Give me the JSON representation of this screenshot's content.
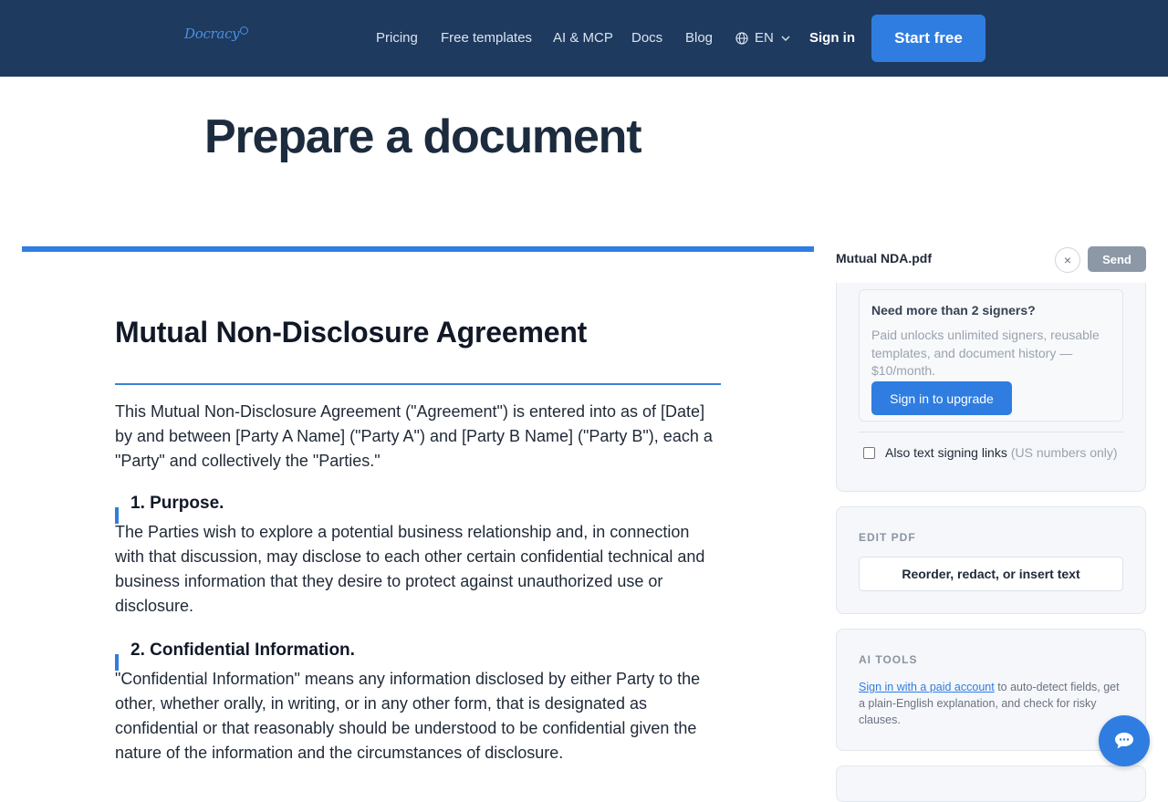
{
  "nav": {
    "logo": "Docracy",
    "links": [
      "Pricing",
      "Free templates",
      "AI & MCP",
      "Docs",
      "Blog"
    ],
    "lang": "EN",
    "signin": "Sign in",
    "cta": "Start free"
  },
  "page": {
    "title": "Prepare a document"
  },
  "document": {
    "title": "Mutual Non-Disclosure Agreement",
    "intro": "This Mutual Non-Disclosure Agreement (\"Agreement\") is entered into as of [Date] by and between [Party A Name] (\"Party A\") and [Party B Name] (\"Party B\"), each a \"Party\" and collectively the \"Parties.\"",
    "sections": [
      {
        "heading": "1. Purpose.",
        "body": "The Parties wish to explore a potential business relationship and, in connection with that discussion, may disclose to each other certain confidential technical and business information that they desire to protect against unauthorized use or disclosure."
      },
      {
        "heading": "2. Confidential Information.",
        "body": "\"Confidential Information\" means any information disclosed by either Party to the other, whether orally, in writing, or in any other form, that is designated as confidential or that reasonably should be understood to be confidential given the nature of the information and the circumstances of disclosure."
      }
    ]
  },
  "sidebar": {
    "filename": "Mutual NDA.pdf",
    "close_label": "×",
    "send_label": "Send",
    "upsell": {
      "title": "Need more than 2 signers?",
      "text": "Paid unlocks unlimited signers, reusable templates, and document history — $10/month.",
      "button": "Sign in to upgrade"
    },
    "sms": {
      "label": "Also text signing links",
      "note": "(US numbers only)",
      "checked": false
    },
    "edit_pdf": {
      "label": "EDIT PDF",
      "button": "Reorder, redact, or insert text"
    },
    "ai_tools": {
      "label": "AI TOOLS",
      "link": "Sign in with a paid account",
      "text": " to auto-detect fields, get a plain-English explanation, and check for risky clauses."
    }
  },
  "colors": {
    "nav_bg": "#1e3a5f",
    "accent": "#2f7de1",
    "send_disabled": "#8c98a6"
  },
  "icons": [
    "globe-icon",
    "chevron-down-icon",
    "close-icon",
    "chat-icon"
  ]
}
